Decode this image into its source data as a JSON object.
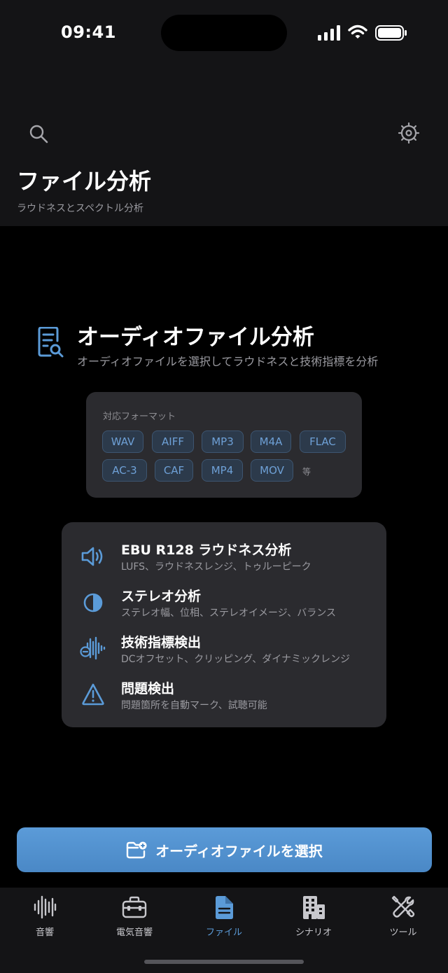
{
  "status_bar": {
    "time": "09:41"
  },
  "header": {
    "title": "ファイル分析",
    "subtitle": "ラウドネスとスペクトル分析",
    "search_icon": "search-icon",
    "settings_icon": "gear-icon"
  },
  "hero": {
    "icon": "document-search-icon",
    "title": "オーディオファイル分析",
    "subtitle": "オーディオファイルを選択してラウドネスと技術指標を分析"
  },
  "formats": {
    "label": "対応フォーマット",
    "items": [
      "WAV",
      "AIFF",
      "MP3",
      "M4A",
      "FLAC",
      "AC-3",
      "CAF",
      "MP4",
      "MOV"
    ],
    "etc": "等"
  },
  "features": [
    {
      "icon": "speaker-icon",
      "title": "EBU R128 ラウドネス分析",
      "desc": "LUFS、ラウドネスレンジ、トゥルーピーク"
    },
    {
      "icon": "half-circle-icon",
      "title": "ステレオ分析",
      "desc": "ステレオ幅、位相、ステレオイメージ、バランス"
    },
    {
      "icon": "waveform-icon",
      "title": "技術指標検出",
      "desc": "DCオフセット、クリッピング、ダイナミックレンジ"
    },
    {
      "icon": "warning-icon",
      "title": "問題検出",
      "desc": "問題箇所を自動マーク、試聴可能"
    }
  ],
  "cta": {
    "label": "オーディオファイルを選択",
    "icon": "folder-add-icon"
  },
  "tabs": [
    {
      "label": "音響",
      "icon": "waveform-icon",
      "active": false
    },
    {
      "label": "電気音響",
      "icon": "toolbox-icon",
      "active": false
    },
    {
      "label": "ファイル",
      "icon": "document-icon",
      "active": true
    },
    {
      "label": "シナリオ",
      "icon": "building-icon",
      "active": false
    },
    {
      "label": "ツール",
      "icon": "tools-icon",
      "active": false
    }
  ],
  "colors": {
    "accent": "#5b9bd8",
    "background": "#000000",
    "card": "#2b2b2f",
    "header": "#141416",
    "secondary_text": "#9a9aa0"
  }
}
